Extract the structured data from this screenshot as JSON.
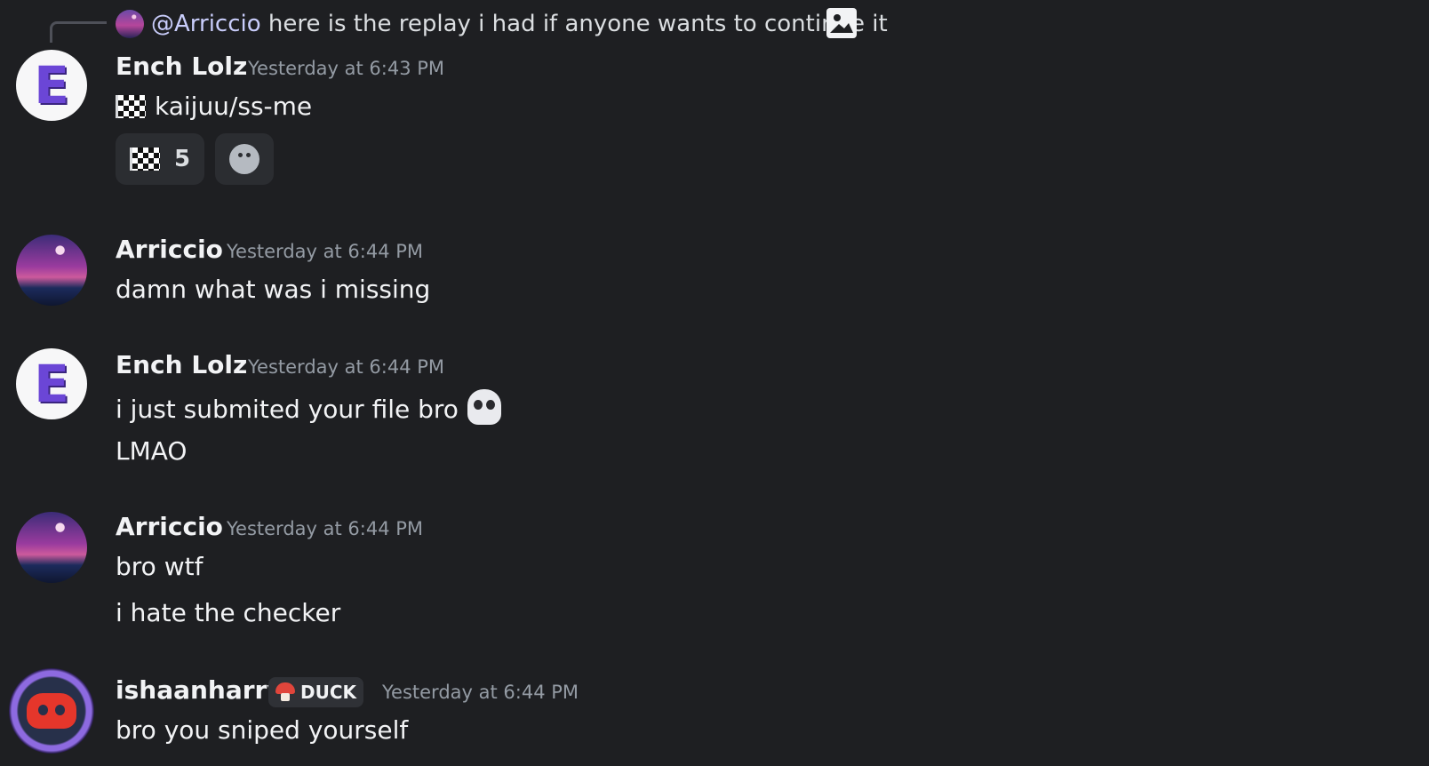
{
  "reply": {
    "mention": "@Arriccio",
    "text": "here is the replay i had if anyone wants to continue it",
    "icon": "image-icon"
  },
  "messages": [
    {
      "author": "Ench Lolz",
      "timestamp": "Yesterday at 6:43 PM",
      "lines": [
        "kaijuu/ss-me"
      ],
      "reactions": [
        {
          "emoji": "checkered-flag",
          "count": "5"
        }
      ]
    },
    {
      "author": "Arriccio",
      "timestamp": "Yesterday at 6:44 PM",
      "lines": [
        "damn what was i missing"
      ]
    },
    {
      "author": "Ench Lolz",
      "timestamp": "Yesterday at 6:44 PM",
      "lines": [
        "i just submited your file bro",
        "LMAO"
      ]
    },
    {
      "author": "Arriccio",
      "timestamp": "Yesterday at 6:44 PM",
      "lines": [
        "bro wtf",
        "i hate the checker"
      ]
    },
    {
      "author": "ishaanharry",
      "badge": "DUCK",
      "timestamp": "Yesterday at 6:44 PM",
      "lines": [
        "bro you sniped yourself"
      ]
    }
  ],
  "colors": {
    "background": "#1e1f22",
    "mention": "#c9cdfb",
    "timestamp": "#949ba4"
  }
}
